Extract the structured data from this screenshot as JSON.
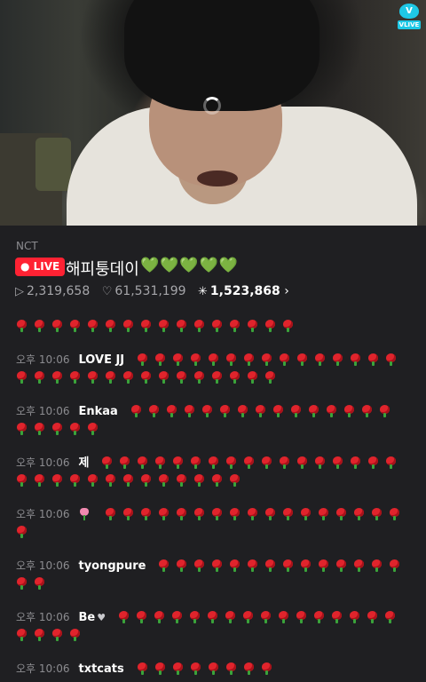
{
  "app": {
    "brand": "VLIVE",
    "brand_color": "#1ec8e6",
    "live_color": "#ff2233"
  },
  "broadcast": {
    "channel": "NCT",
    "live_label": "LIVE",
    "title": "해피퉁데이",
    "title_emoji": "💚💚💚💚💚",
    "views": "2,319,658",
    "likes": "61,531,199",
    "loading_count": "1,523,868"
  },
  "chat": {
    "messages": [
      {
        "time": "",
        "user": "",
        "roses_line1": 16,
        "roses_line2": 0
      },
      {
        "time": "오후 10:06",
        "user": "LOVE JJ",
        "roses_line1": 15,
        "roses_line2": 15
      },
      {
        "time": "오후 10:06",
        "user": "Enkaa",
        "roses_line1": 15,
        "roses_line2": 5
      },
      {
        "time": "오후 10:06",
        "user": "제",
        "roses_line1": 17,
        "roses_line2": 13
      },
      {
        "time": "오후 10:06",
        "user": "",
        "user_icon": "tulip-icon",
        "roses_line1": 17,
        "roses_line2": 1
      },
      {
        "time": "오후 10:06",
        "user": "tyongpure",
        "roses_line1": 14,
        "roses_line2": 2
      },
      {
        "time": "오후 10:06",
        "user": "Be",
        "user_icon": "white-heart-icon",
        "roses_line1": 16,
        "roses_line2": 4
      },
      {
        "time": "오후 10:06",
        "user": "txtcats",
        "roses_line1": 8,
        "roses_line2": 0
      }
    ]
  }
}
